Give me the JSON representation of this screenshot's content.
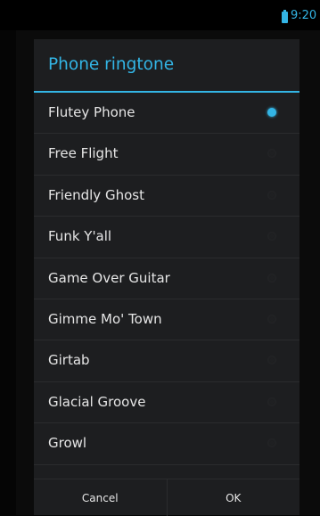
{
  "status": {
    "time": "9:20",
    "battery_icon": "battery-icon"
  },
  "dialog": {
    "title": "Phone ringtone",
    "items": [
      {
        "label": "Flutey Phone",
        "selected": true
      },
      {
        "label": "Free Flight",
        "selected": false
      },
      {
        "label": "Friendly Ghost",
        "selected": false
      },
      {
        "label": "Funk Y'all",
        "selected": false
      },
      {
        "label": "Game Over Guitar",
        "selected": false
      },
      {
        "label": "Gimme Mo' Town",
        "selected": false
      },
      {
        "label": "Girtab",
        "selected": false
      },
      {
        "label": "Glacial Groove",
        "selected": false
      },
      {
        "label": "Growl",
        "selected": false
      }
    ],
    "cancel_label": "Cancel",
    "ok_label": "OK"
  },
  "colors": {
    "accent": "#33b5e5",
    "dialog_bg": "#1d1e20"
  }
}
